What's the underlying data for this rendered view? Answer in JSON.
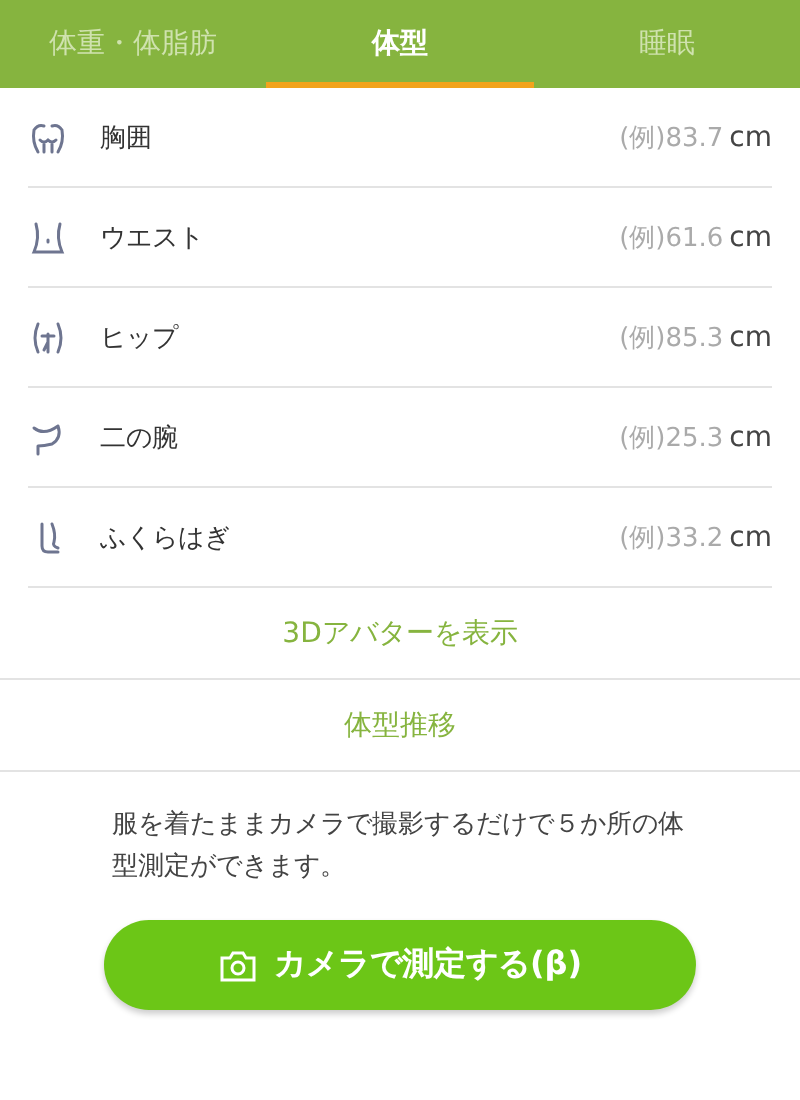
{
  "tabs": [
    {
      "label": "体重・体脂肪",
      "selected": false
    },
    {
      "label": "体型",
      "selected": true
    },
    {
      "label": "睡眠",
      "selected": false
    }
  ],
  "measurements": [
    {
      "kind": "chest",
      "name": "胸囲",
      "value": "(例)83.7",
      "unit": "cm"
    },
    {
      "kind": "waist",
      "name": "ウエスト",
      "value": "(例)61.6",
      "unit": "cm"
    },
    {
      "kind": "hip",
      "name": "ヒップ",
      "value": "(例)85.3",
      "unit": "cm"
    },
    {
      "kind": "arm",
      "name": "二の腕",
      "value": "(例)25.3",
      "unit": "cm"
    },
    {
      "kind": "calf",
      "name": "ふくらはぎ",
      "value": "(例)33.2",
      "unit": "cm"
    }
  ],
  "links": [
    "3Dアバターを表示",
    "体型推移"
  ],
  "description": "服を着たままカメラで撮影するだけで５か所の体型測定ができます。",
  "camera_button": "カメラで測定する(β)"
}
